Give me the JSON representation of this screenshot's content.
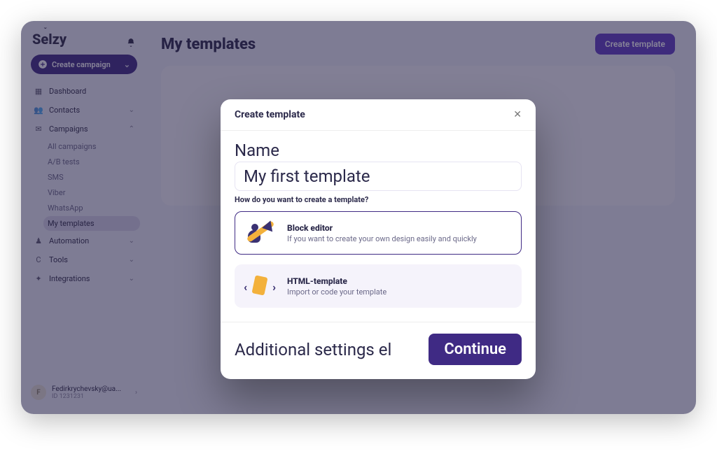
{
  "brand": "Selzy",
  "header": {
    "create_campaign_label": "Create campaign"
  },
  "sidebar": {
    "items": [
      {
        "label": "Dashboard",
        "icon": "dashboard"
      },
      {
        "label": "Contacts",
        "icon": "contacts",
        "expandable": true
      },
      {
        "label": "Campaigns",
        "icon": "campaigns",
        "expandable": true,
        "expanded": true,
        "children": [
          {
            "label": "All campaigns"
          },
          {
            "label": "A/B tests"
          },
          {
            "label": "SMS"
          },
          {
            "label": "Viber"
          },
          {
            "label": "WhatsApp"
          },
          {
            "label": "My templates",
            "active": true
          }
        ]
      },
      {
        "label": "Automation",
        "icon": "automation",
        "expandable": true
      },
      {
        "label": "Tools",
        "icon": "tools",
        "expandable": true
      },
      {
        "label": "Integrations",
        "icon": "integrations",
        "expandable": true
      }
    ]
  },
  "account": {
    "avatar_letter": "F",
    "email": "Fedirkrychevsky@ua...",
    "id_label": "ID 1231231"
  },
  "page": {
    "title": "My templates",
    "create_template_button": "Create template"
  },
  "modal": {
    "title": "Create template",
    "name_label": "Name",
    "name_value": "My first template",
    "how_label": "How do you want to create a template?",
    "options": [
      {
        "title": "Block editor",
        "desc": "If you want to create your own design easily and quickly",
        "selected": true,
        "kind": "block"
      },
      {
        "title": "HTML-template",
        "desc": "Import or code your template",
        "selected": false,
        "kind": "html"
      }
    ],
    "additional_settings_label": "Additional settings el",
    "continue_label": "Continue"
  }
}
